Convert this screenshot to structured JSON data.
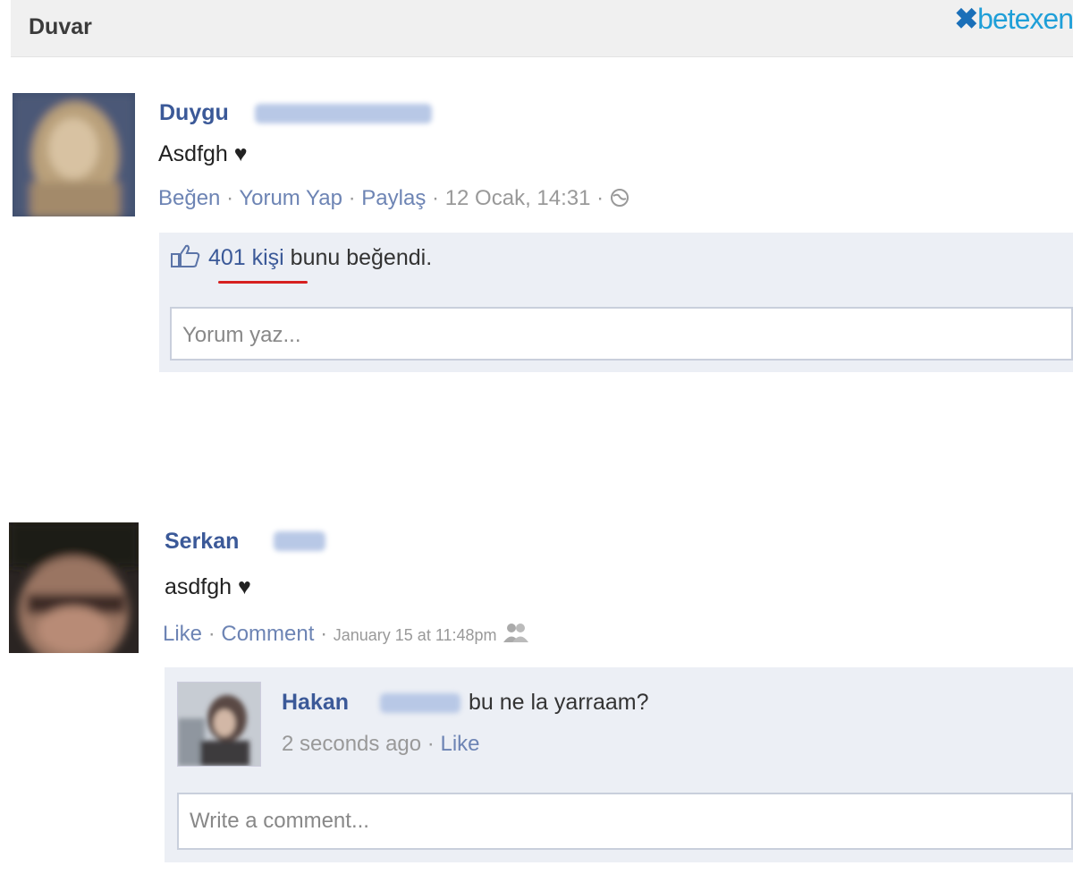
{
  "header": {
    "title": "Duvar",
    "logo": "betexen"
  },
  "posts": [
    {
      "author": "Duygu",
      "text": "Asdfgh ♥",
      "actions": [
        "Beğen",
        "Yorum Yap",
        "Paylaş"
      ],
      "time": "12 Ocak, 14:31",
      "privacy_icon": "globe-icon",
      "likes": {
        "count": "401 kişi",
        "suffix": " bunu beğendi."
      },
      "comment_placeholder": "Yorum yaz..."
    },
    {
      "author": "Serkan",
      "text": "asdfgh ♥",
      "actions": [
        "Like",
        "Comment"
      ],
      "time": "January 15 at 11:48pm",
      "privacy_icon": "friends-icon",
      "comment": {
        "author": "Hakan",
        "text": "bu ne la yarraam?",
        "time": "2 seconds ago",
        "action": "Like"
      },
      "comment_placeholder": "Write a comment..."
    }
  ],
  "colors": {
    "link": "#3b5998",
    "panel": "#eceff5",
    "underline": "#d62020"
  }
}
